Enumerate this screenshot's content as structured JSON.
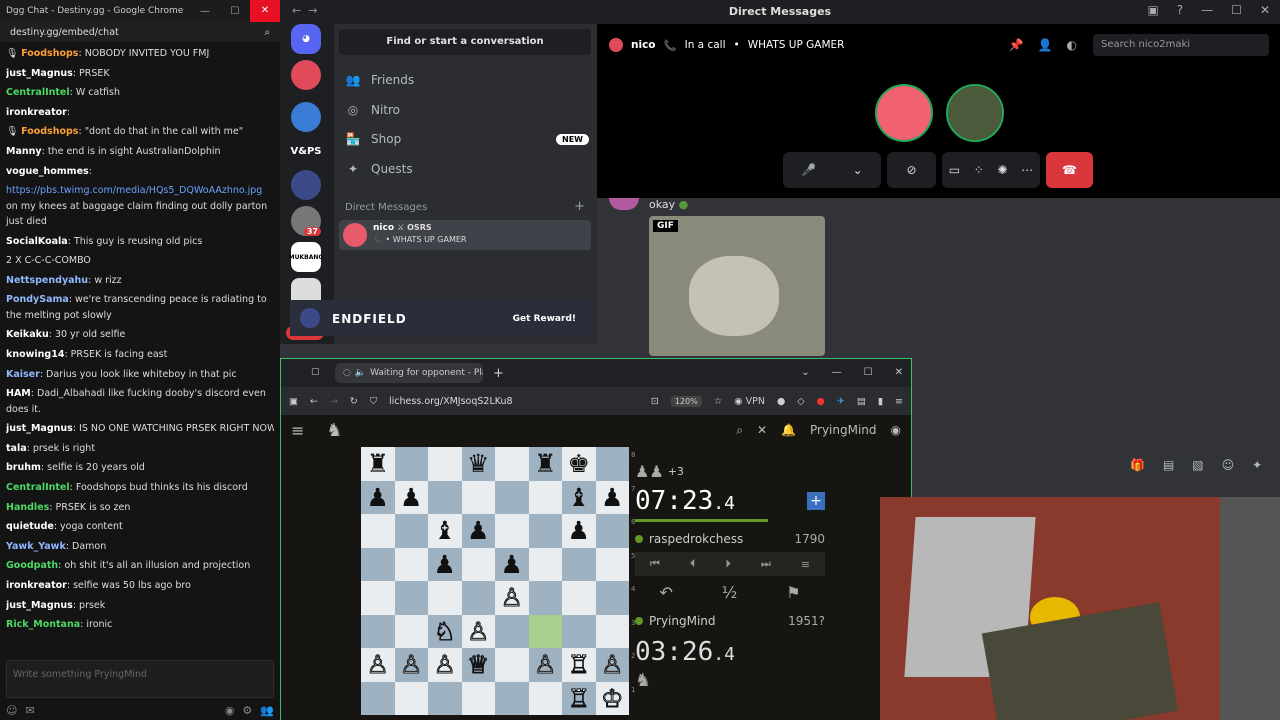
{
  "chat": {
    "window_title": "Dgg Chat - Destiny.gg - Google Chrome",
    "url": "destiny.gg/embed/chat",
    "input_placeholder": "Write something PryingMind",
    "messages": [
      {
        "user": "Foodshops",
        "color": "#ff9f33",
        "text": "NOBODY INVITED YOU FMJ",
        "flair": true
      },
      {
        "user": "just_Magnus",
        "color": "#ffffff",
        "text": "PRSEK"
      },
      {
        "user": "CentralIntel",
        "color": "#4cd964",
        "text": "W catfish"
      },
      {
        "user": "ironkreator",
        "color": "#ffffff",
        "text": ""
      },
      {
        "user": "Foodshops",
        "color": "#ff9f33",
        "text": "\"dont do that in the call with me\"",
        "flair": true
      },
      {
        "user": "Manny",
        "color": "#ffffff",
        "text": "the end is in sight  AustralianDolphin"
      },
      {
        "user": "vogue_hommes",
        "color": "#ffffff",
        "text": ""
      },
      {
        "user": "",
        "color": "#ffffff",
        "text": "",
        "link": "https://pbs.twimg.com/media/HQs5_DQWoAAzhno.jpg",
        "after": " on my knees at baggage claim finding out dolly parton just died",
        "wrap": true
      },
      {
        "user": "SocialKoala",
        "color": "#ffffff",
        "text": "This guy is reusing old pics"
      },
      {
        "user": "",
        "color": "#ffffff",
        "text": "2 X C-C-C-COMBO"
      },
      {
        "user": "Nettspendyahu",
        "color": "#8fb8ff",
        "text": "w rizz"
      },
      {
        "user": "PondySama",
        "color": "#8fb8ff",
        "text": "we're transcending     peace is radiating to the melting pot slowly",
        "wrap": true
      },
      {
        "user": "Keikaku",
        "color": "#ffffff",
        "text": "30 yr old selfie"
      },
      {
        "user": "knowing14",
        "color": "#ffffff",
        "text": "PRSEK is facing east"
      },
      {
        "user": "Kaiser",
        "color": "#8fb8ff",
        "text": "Darius you look like whiteboy in that pic"
      },
      {
        "user": "HAM",
        "color": "#ffffff",
        "text": "Dadi_Albahadi like fucking dooby's discord even does it.",
        "wrap": true
      },
      {
        "user": "just_Magnus",
        "color": "#ffffff",
        "text": "IS NO ONE WATCHING PRSEK RIGHT NOW?"
      },
      {
        "user": "tala",
        "color": "#ffffff",
        "text": "prsek is right"
      },
      {
        "user": "bruhm",
        "color": "#ffffff",
        "text": "selfie is 20 years old"
      },
      {
        "user": "CentralIntel",
        "color": "#4cd964",
        "text": "Foodshops bud thinks its his discord"
      },
      {
        "user": "Handles",
        "color": "#4cd964",
        "text": "PRSEK is so zen"
      },
      {
        "user": "quietude",
        "color": "#ffffff",
        "text": "yoga content"
      },
      {
        "user": "Yawk_Yawk",
        "color": "#8fb8ff",
        "text": "Damon"
      },
      {
        "user": "Goodpath",
        "color": "#4cd964",
        "text": "oh shit it's all an illusion and projection"
      },
      {
        "user": "ironkreator",
        "color": "#ffffff",
        "text": "selfie was 50 lbs ago bro"
      },
      {
        "user": "just_Magnus",
        "color": "#ffffff",
        "text": "prsek"
      },
      {
        "user": "Rick_Montana",
        "color": "#4cd964",
        "text": "ironic"
      }
    ]
  },
  "discord": {
    "title": "Direct Messages",
    "find": "Find or start a conversation",
    "nav": [
      {
        "icon": "👥",
        "label": "Friends"
      },
      {
        "icon": "◎",
        "label": "Nitro"
      },
      {
        "icon": "🏪",
        "label": "Shop",
        "badge": "NEW"
      },
      {
        "icon": "✦",
        "label": "Quests"
      }
    ],
    "dm_header": "Direct Messages",
    "dm_plus": "+",
    "dm_item": {
      "name": "nico",
      "tag": "OSRS",
      "status": "• WHATS UP GAMER"
    },
    "guild_labels": {
      "vps": "V&PS",
      "mukbang": "MUKBANG",
      "badge37": "37",
      "new": "NEW"
    },
    "promo": {
      "logo": "ENDFIELD",
      "button": "Get Reward!"
    },
    "call": {
      "name": "nico",
      "status": "In a call",
      "status_text": "WHATS UP GAMER",
      "search_placeholder": "Search nico2maki"
    },
    "message_text": "okay",
    "gif_label": "GIF"
  },
  "lichess": {
    "tab_title": "Waiting for opponent - Pla",
    "url": "lichess.org/XMJsoqS2LKu8",
    "zoom": "120%",
    "vpn": "VPN",
    "username": "PryingMind",
    "top_extra": "+3",
    "opponent": {
      "name": "raspedrokchess",
      "rating": "1790",
      "clock_main": "07:23",
      "clock_frac": ".4"
    },
    "me": {
      "name": "PryingMind",
      "rating": "1951?",
      "clock_main": "03:26",
      "clock_frac": ".4"
    },
    "half": "½",
    "ranks": [
      "8",
      "7",
      "6",
      "5",
      "4",
      "3",
      "2",
      "1"
    ],
    "board": [
      [
        "♜",
        "",
        "",
        "♛",
        "",
        "♜",
        "♚",
        ""
      ],
      [
        "♟",
        "♟",
        "",
        "",
        "",
        "",
        "♝",
        "♟"
      ],
      [
        "",
        "",
        "♝",
        "♟",
        "",
        "",
        "♟",
        ""
      ],
      [
        "",
        "",
        "♟",
        "",
        "♟",
        "",
        "",
        ""
      ],
      [
        "",
        "",
        "",
        "",
        "♙",
        "",
        "",
        ""
      ],
      [
        "",
        "",
        "♘",
        "♙",
        "",
        "",
        "",
        ""
      ],
      [
        "♙",
        "♙",
        "♙",
        "♕",
        "",
        "♙",
        "♖",
        "♙"
      ],
      [
        "",
        "",
        "",
        "",
        "",
        "",
        "♖",
        "♔"
      ]
    ]
  }
}
